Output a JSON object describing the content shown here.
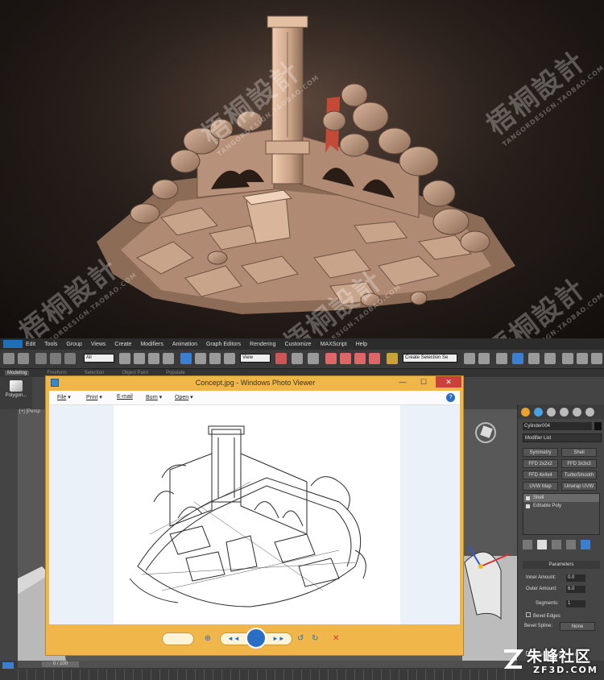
{
  "watermark": {
    "brand_cn": "梧桐設計",
    "brand_en": "TANGORDESIGN.TAOBAO.COM",
    "registered": "®"
  },
  "menubar": {
    "items": [
      "Edit",
      "Tools",
      "Group",
      "Views",
      "Create",
      "Modifiers",
      "Animation",
      "Graph Editors",
      "Rendering",
      "Customize",
      "MAXScript",
      "Help"
    ]
  },
  "toolbar": {
    "filter_select": "All",
    "refcoord_select": "View",
    "named_selection": "Create Selection Se"
  },
  "ribbon": {
    "tabs": [
      "Modeling",
      "Freeform",
      "Selection",
      "Object Paint",
      "Populate"
    ],
    "polygon_button": "Polygon..."
  },
  "viewport": {
    "label": "[+] [Persp"
  },
  "command_panel": {
    "object_name": "Cylinder004",
    "modifier_list": "Modifier List",
    "modifier_buttons": [
      "Symmetry",
      "Shell",
      "FFD 2x2x2",
      "FFD 3x3x3",
      "FFD 4x4x4",
      "TurboSmooth",
      "UVW Map",
      "Unwrap UVW"
    ],
    "stack": [
      "Shell",
      "Editable Poly"
    ],
    "parameters_title": "Parameters",
    "params": [
      {
        "label": "Inner Amount:",
        "value": "0.0"
      },
      {
        "label": "Outer Amount:",
        "value": "6.0"
      },
      {
        "label": "Segments:",
        "value": "1"
      }
    ],
    "bevel_edges": "Bevel Edges",
    "bevel_spline": "Bevel Spline:",
    "bevel_spline_value": "None",
    "override_inner": "Override Inner Mat ID"
  },
  "photo_viewer": {
    "title": "Concept.jpg - Windows Photo Viewer",
    "menu": [
      "File",
      "Print",
      "E-mail",
      "Burn",
      "Open"
    ],
    "help": "?",
    "close": "✕"
  },
  "timeline": {
    "frame": "0 / 100"
  },
  "site_logo": {
    "cn": "朱峰社区",
    "en": "ZF3D.COM"
  }
}
